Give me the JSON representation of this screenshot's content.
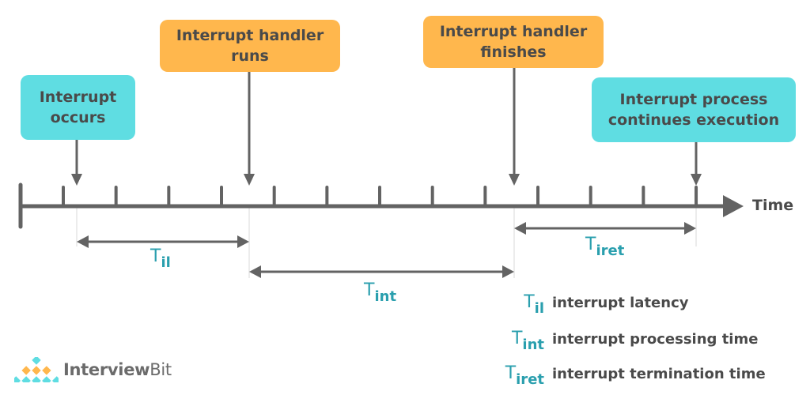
{
  "events": [
    {
      "id": "interrupt-occurs",
      "label_line1": "Interrupt",
      "label_line2": "occurs",
      "color": "#5fdde2"
    },
    {
      "id": "handler-runs",
      "label_line1": "Interrupt handler",
      "label_line2": "runs",
      "color": "#ffb74d"
    },
    {
      "id": "handler-finishes",
      "label_line1": "Interrupt handler",
      "label_line2": "finishes",
      "color": "#ffb74d"
    },
    {
      "id": "process-continues",
      "label_line1": "Interrupt process",
      "label_line2": "continues execution",
      "color": "#5fdde2"
    }
  ],
  "axis": {
    "label": "Time",
    "tick_count": 13
  },
  "intervals": [
    {
      "symbol": "T",
      "subscript": "il",
      "from": "interrupt-occurs",
      "to": "handler-runs"
    },
    {
      "symbol": "T",
      "subscript": "int",
      "from": "handler-runs",
      "to": "handler-finishes"
    },
    {
      "symbol": "T",
      "subscript": "iret",
      "from": "handler-finishes",
      "to": "process-continues"
    }
  ],
  "legend": [
    {
      "symbol": "T",
      "subscript": "il",
      "text": "interrupt latency"
    },
    {
      "symbol": "T",
      "subscript": "int",
      "text": "interrupt processing time"
    },
    {
      "symbol": "T",
      "subscript": "iret",
      "text": "interrupt termination time"
    }
  ],
  "brand": {
    "name_bold": "Interview",
    "name_regular": "Bit"
  },
  "colors": {
    "cyan": "#5fdde2",
    "orange": "#ffb74d",
    "axis": "#636363",
    "accent_text": "#2a9fae",
    "text": "#4a4a4a"
  }
}
